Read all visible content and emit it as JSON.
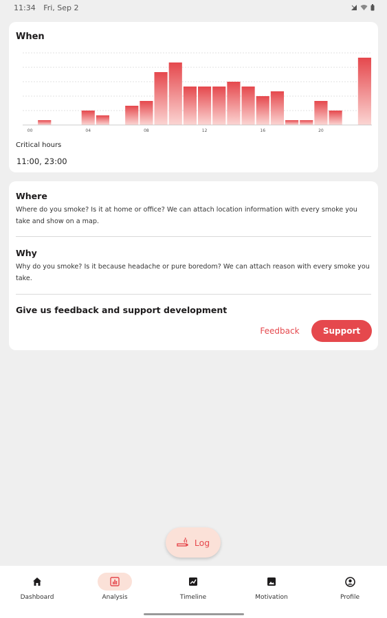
{
  "status_bar": {
    "time": "11:34",
    "date": "Fri, Sep 2",
    "icons": [
      "signal-icon",
      "wifi-icon",
      "battery-icon"
    ]
  },
  "when_card": {
    "title": "When",
    "critical_label": "Critical hours",
    "critical_value": "11:00, 23:00"
  },
  "chart_data": {
    "type": "bar",
    "categories": [
      "00",
      "01",
      "02",
      "03",
      "04",
      "05",
      "06",
      "07",
      "08",
      "09",
      "10",
      "11",
      "12",
      "13",
      "14",
      "15",
      "16",
      "17",
      "18",
      "19",
      "20",
      "21",
      "22",
      "23"
    ],
    "tick_labels": [
      "00",
      "04",
      "08",
      "12",
      "16",
      "20"
    ],
    "values": [
      0,
      0.5,
      0,
      0,
      1.5,
      1,
      0,
      2,
      2.5,
      5.5,
      6.5,
      4,
      4,
      4,
      4.5,
      4,
      3,
      3.5,
      0.5,
      0.5,
      2.5,
      1.5,
      0,
      7
    ],
    "ylim": [
      0,
      8
    ],
    "grid": true,
    "bar_color_top": "#e5484d",
    "bar_color_bottom": "#fbd5d3"
  },
  "info_card": {
    "where_title": "Where",
    "where_desc": "Where do you smoke? Is it at home or office? We can attach location information with every smoke you take and show on a map.",
    "why_title": "Why",
    "why_desc": "Why do you smoke? Is it because headache or pure boredom? We can attach reason with every smoke you take.",
    "feedback_title": "Give us feedback and support development",
    "feedback_label": "Feedback",
    "support_label": "Support"
  },
  "fab": {
    "label": "Log"
  },
  "nav": {
    "items": [
      {
        "label": "Dashboard",
        "icon": "home-icon"
      },
      {
        "label": "Analysis",
        "icon": "analysis-icon"
      },
      {
        "label": "Timeline",
        "icon": "timeline-icon"
      },
      {
        "label": "Motivation",
        "icon": "image-icon"
      },
      {
        "label": "Profile",
        "icon": "profile-icon"
      }
    ],
    "active_index": 1
  },
  "colors": {
    "accent": "#e5484d",
    "accent_light": "#fbe1d8",
    "background": "#efefef"
  }
}
